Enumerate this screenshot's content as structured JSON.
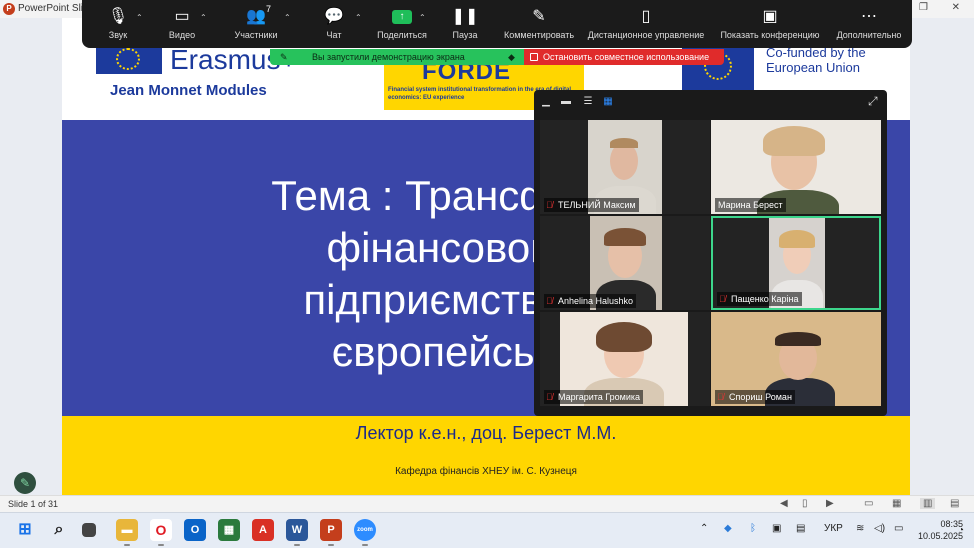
{
  "window": {
    "app_title": "PowerPoint Slide",
    "restore_glyph": "❐",
    "close_glyph": "✕"
  },
  "zoom_toolbar": {
    "items": [
      {
        "id": "audio",
        "label": "Звук",
        "icon": "microphone-icon"
      },
      {
        "id": "video",
        "label": "Видео",
        "icon": "camera-icon"
      },
      {
        "id": "participants",
        "label": "Участники",
        "icon": "participants-icon",
        "count": "7"
      },
      {
        "id": "chat",
        "label": "Чат",
        "icon": "chat-icon"
      },
      {
        "id": "share",
        "label": "Поделиться",
        "icon": "share-screen-icon"
      },
      {
        "id": "pause",
        "label": "Пауза",
        "icon": "pause-icon"
      },
      {
        "id": "annotate",
        "label": "Комментировать",
        "icon": "pen-icon"
      },
      {
        "id": "remote",
        "label": "Дистанционное управление",
        "icon": "mouse-icon"
      },
      {
        "id": "show_conf",
        "label": "Показать конференцию",
        "icon": "screen-icon"
      },
      {
        "id": "more",
        "label": "Дополнительно",
        "icon": "more-icon"
      }
    ],
    "share_banner": "Вы запустили демонстрацию экрана",
    "stop_share": "Остановить совместное использование"
  },
  "slide": {
    "erasmus": "Erasmus+",
    "jean_monnet": "Jean Monnet Modules",
    "forde": "FORDE",
    "forde_sub": "Financial system institutional transformation in the era of digital economics: EU experience",
    "cofunded": "Co-funded by the\nEuropean Union",
    "title_lines": [
      "Тема : Трансформа",
      "фінансовою б",
      "підприємств Укр",
      "європейськог"
    ],
    "lecturer": "Лектор к.е.н., доц. Берест М.М.",
    "department": "Кафедра фінансів ХНЕУ ім. С. Кузнеця"
  },
  "gallery": {
    "participants": [
      {
        "name": "ТЕЛЬНИЙ Максим",
        "muted": true,
        "active": false
      },
      {
        "name": "Марина Берест",
        "muted": false,
        "active": false
      },
      {
        "name": "Anhelina Halushko",
        "muted": true,
        "active": false
      },
      {
        "name": "Пащенко Каріна",
        "muted": true,
        "active": true
      },
      {
        "name": "Маргарита Громика",
        "muted": true,
        "active": false
      },
      {
        "name": "Спориш Роман",
        "muted": true,
        "active": false
      }
    ]
  },
  "status_bar": {
    "slide_counter": "Slide 1 of 31"
  },
  "taskbar": {
    "language": "УКР",
    "time": "08:35",
    "date": "10.05.2025"
  },
  "colors": {
    "slide_blue": "#3a46a8",
    "slide_yellow": "#ffd600",
    "share_green": "#27c25c",
    "stop_red": "#e02b2b",
    "active_speaker": "#3dd68c"
  }
}
